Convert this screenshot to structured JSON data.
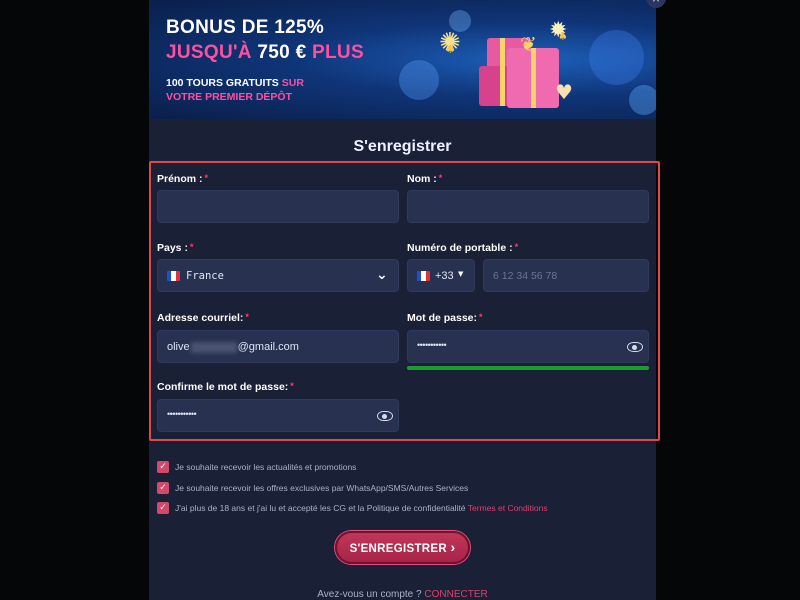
{
  "banner": {
    "line1": "BONUS DE 125%",
    "line2_prefix": "JUSQU'À",
    "line2_amount": "750 €",
    "line2_suffix": "PLUS",
    "line3_prefix": "100 TOURS GRATUITS",
    "line3_suffix": "SUR",
    "line4": "VOTRE PREMIER DÉPÔT"
  },
  "close_icon": "×",
  "title": "S'enregistrer",
  "fields": {
    "prenom": {
      "label": "Prénom :",
      "value": ""
    },
    "nom": {
      "label": "Nom :",
      "value": ""
    },
    "pays": {
      "label": "Pays :",
      "value": "France"
    },
    "phone": {
      "label": "Numéro de portable :",
      "code": "+33",
      "placeholder": "6 12 34 56 78"
    },
    "email": {
      "label": "Adresse courriel:",
      "value_start": "olive",
      "value_end": "@gmail.com"
    },
    "password": {
      "label": "Mot de passe:",
      "value": "•••••••••••"
    },
    "confirm": {
      "label": "Confirme le mot de passe:",
      "value": "•••••••••••"
    }
  },
  "required_mark": "*",
  "checkboxes": [
    {
      "text": "Je souhaite recevoir les actualités et promotions",
      "checked": true
    },
    {
      "text": "Je souhaite recevoir les offres exclusives par WhatsApp/SMS/Autres Services",
      "checked": true
    },
    {
      "text": "J'ai plus de 18 ans et j'ai lu et accepté les CG et la Politique de confidentialité",
      "link": "Termes et Conditions",
      "checked": true
    }
  ],
  "check_glyph": "✓",
  "submit": {
    "label": "S'ENREGISTRER",
    "arrow": "›"
  },
  "footer": {
    "text": "Avez-vous un compte ?",
    "link": "CONNECTER"
  },
  "colors": {
    "accent": "#e23f6a",
    "password_strength": "#1f9b2e",
    "highlight_border": "#e0484d"
  },
  "password_strength": 1.0,
  "icons": [
    "close-icon",
    "chevron-down-icon",
    "caret-down-icon",
    "eye-icon",
    "checkbox-icon",
    "france-flag-icon",
    "arrow-right-icon",
    "gift-icon",
    "heart-icon"
  ]
}
